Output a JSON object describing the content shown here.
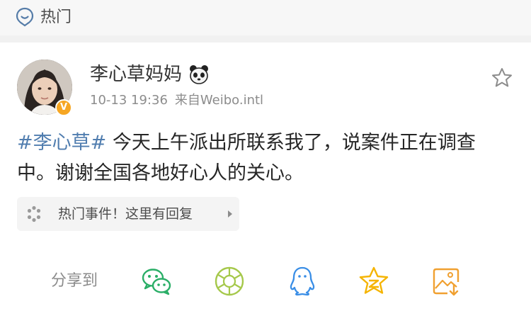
{
  "header": {
    "section_title": "热门",
    "section_icon": "location-pin-icon"
  },
  "post": {
    "author": "李心草妈妈",
    "author_emoji": "panda-icon",
    "verified": true,
    "timestamp": "10-13 19:36",
    "source": "来自Weibo.intl",
    "topic": "#李心草#",
    "body": " 今天上午派出所联系我了，说案件正在调查中。谢谢全国各地好心人的关心。",
    "favorite_icon": "star-outline-icon"
  },
  "hot_reply": {
    "label": "热门事件！这里有回复",
    "icon": "loading-dots-icon"
  },
  "share": {
    "label": "分享到",
    "targets": [
      {
        "name": "wechat-icon",
        "color": "#2aae67"
      },
      {
        "name": "moments-icon",
        "color": "#a5c84a"
      },
      {
        "name": "qq-icon",
        "color": "#3a8ee6"
      },
      {
        "name": "qzone-icon",
        "color": "#f5b400"
      },
      {
        "name": "save-image-icon",
        "color": "#f0a030"
      }
    ]
  }
}
